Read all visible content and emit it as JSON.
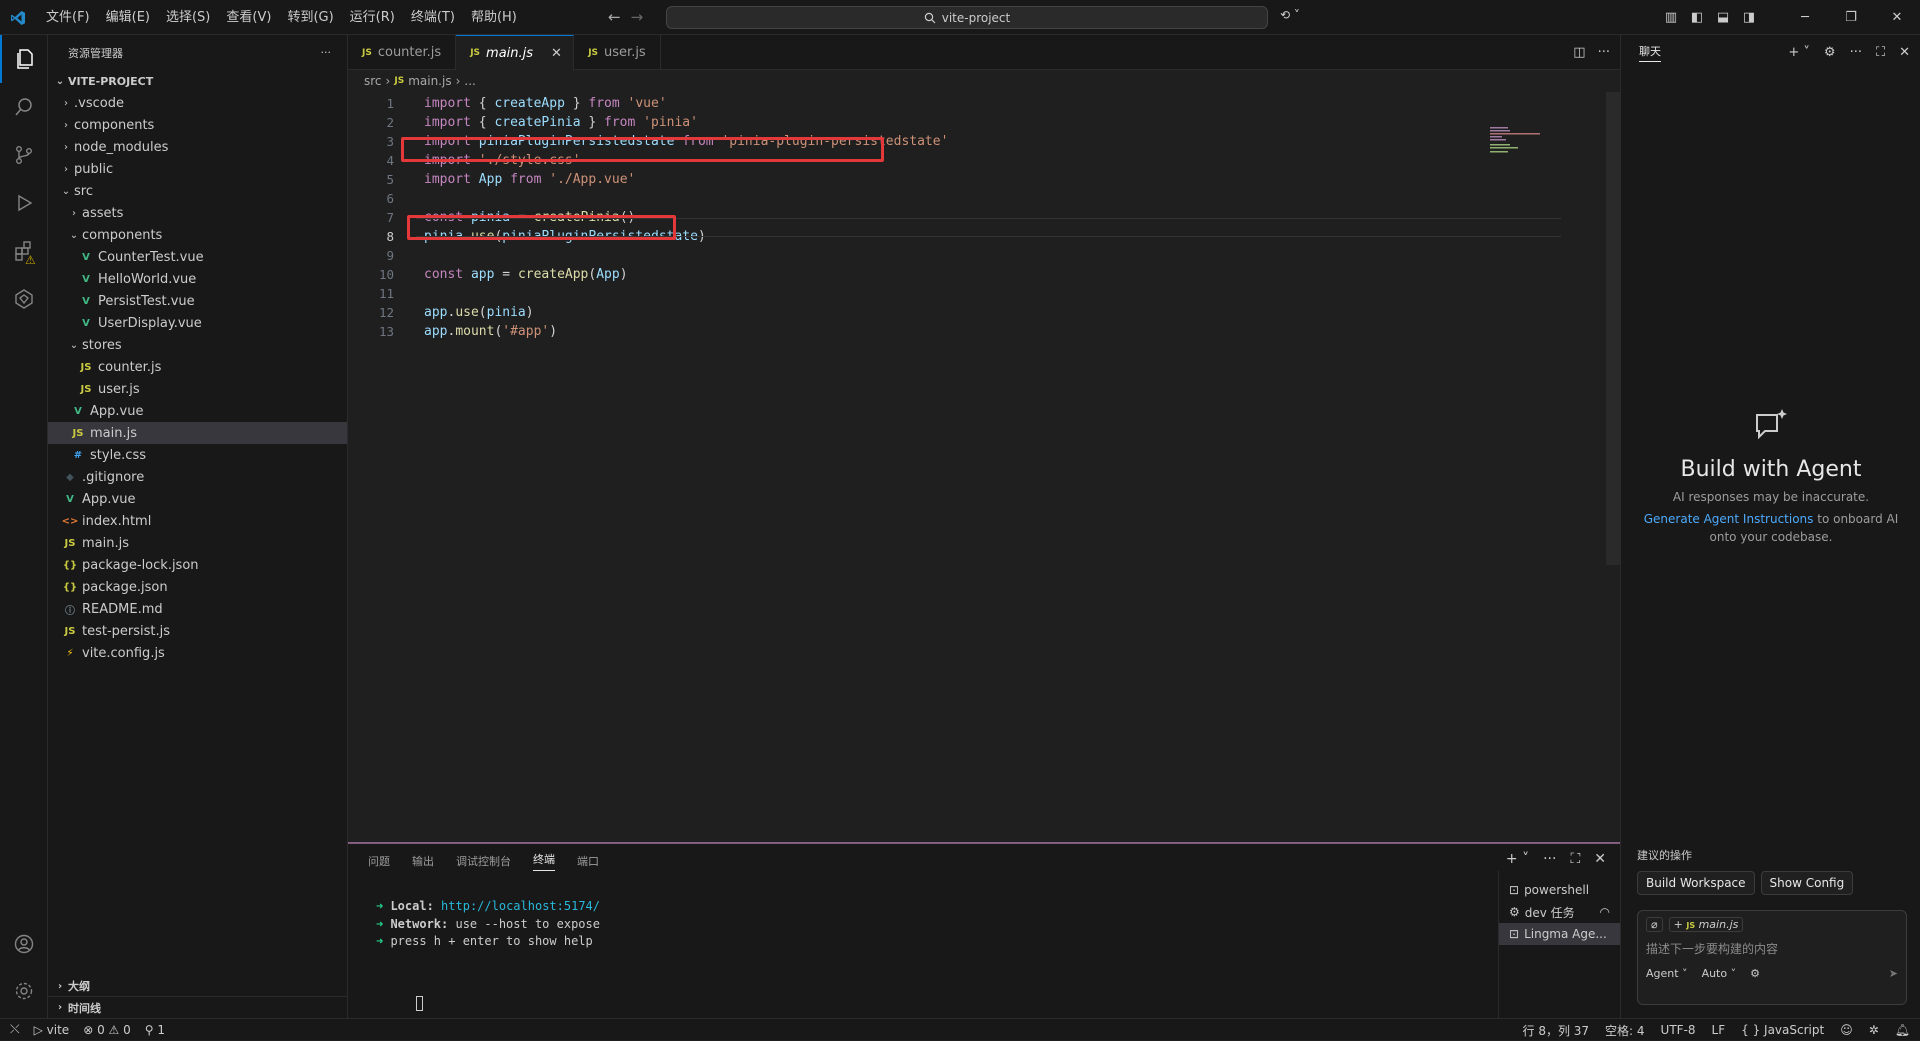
{
  "menu": [
    "文件(F)",
    "编辑(E)",
    "选择(S)",
    "查看(V)",
    "转到(G)",
    "运行(R)",
    "终端(T)",
    "帮助(H)"
  ],
  "search": {
    "text": "vite-project"
  },
  "sidebar": {
    "title": "资源管理器",
    "root": "VITE-PROJECT",
    "tree": [
      {
        "label": ".vscode",
        "depth": 0,
        "kind": "folder",
        "open": false
      },
      {
        "label": "components",
        "depth": 0,
        "kind": "folder",
        "open": false
      },
      {
        "label": "node_modules",
        "depth": 0,
        "kind": "folder",
        "open": false
      },
      {
        "label": "public",
        "depth": 0,
        "kind": "folder",
        "open": false
      },
      {
        "label": "src",
        "depth": 0,
        "kind": "folder",
        "open": true
      },
      {
        "label": "assets",
        "depth": 1,
        "kind": "folder",
        "open": false
      },
      {
        "label": "components",
        "depth": 1,
        "kind": "folder",
        "open": true
      },
      {
        "label": "CounterTest.vue",
        "depth": 2,
        "kind": "vue"
      },
      {
        "label": "HelloWorld.vue",
        "depth": 2,
        "kind": "vue"
      },
      {
        "label": "PersistTest.vue",
        "depth": 2,
        "kind": "vue"
      },
      {
        "label": "UserDisplay.vue",
        "depth": 2,
        "kind": "vue"
      },
      {
        "label": "stores",
        "depth": 1,
        "kind": "folder",
        "open": true
      },
      {
        "label": "counter.js",
        "depth": 2,
        "kind": "js"
      },
      {
        "label": "user.js",
        "depth": 2,
        "kind": "js"
      },
      {
        "label": "App.vue",
        "depth": 1,
        "kind": "vue"
      },
      {
        "label": "main.js",
        "depth": 1,
        "kind": "js",
        "selected": true
      },
      {
        "label": "style.css",
        "depth": 1,
        "kind": "css"
      },
      {
        "label": ".gitignore",
        "depth": 0,
        "kind": "git"
      },
      {
        "label": "App.vue",
        "depth": 0,
        "kind": "vue"
      },
      {
        "label": "index.html",
        "depth": 0,
        "kind": "html"
      },
      {
        "label": "main.js",
        "depth": 0,
        "kind": "js"
      },
      {
        "label": "package-lock.json",
        "depth": 0,
        "kind": "json"
      },
      {
        "label": "package.json",
        "depth": 0,
        "kind": "json"
      },
      {
        "label": "README.md",
        "depth": 0,
        "kind": "info"
      },
      {
        "label": "test-persist.js",
        "depth": 0,
        "kind": "js"
      },
      {
        "label": "vite.config.js",
        "depth": 0,
        "kind": "vite"
      }
    ],
    "outline": "大纲",
    "timeline": "时间线"
  },
  "tabs": [
    {
      "label": "counter.js",
      "active": false
    },
    {
      "label": "main.js",
      "active": true
    },
    {
      "label": "user.js",
      "active": false
    }
  ],
  "breadcrumb": {
    "folder": "src",
    "file": "main.js",
    "more": "..."
  },
  "code": [
    "import { createApp } from 'vue'",
    "import { createPinia } from 'pinia'",
    "import piniaPluginPersistedstate from 'pinia-plugin-persistedstate'",
    "import './style.css'",
    "import App from './App.vue'",
    "",
    "const pinia = createPinia()",
    "pinia.use(piniaPluginPersistedstate)",
    "",
    "const app = createApp(App)",
    "",
    "app.use(pinia)",
    "app.mount('#app')"
  ],
  "cursor_line": 8,
  "highlighted_lines": [
    3,
    8
  ],
  "panel": {
    "tabs": [
      "问题",
      "输出",
      "调试控制台",
      "终端",
      "端口"
    ],
    "active_tab": "终端",
    "terminal": {
      "local_label": "Local:",
      "local_url": "http://localhost:5174/",
      "network_label": "Network:",
      "network_text": "use --host to expose",
      "help_text": "press h + enter to show help"
    },
    "terminals": [
      "powershell",
      "dev 任务",
      "Lingma Age..."
    ]
  },
  "chat": {
    "title": "聊天",
    "heading": "Build with Agent",
    "sub": "AI responses may be inaccurate.",
    "link": "Generate Agent Instructions",
    "link_rest": "to onboard AI onto your codebase.",
    "suggest_label": "建议的操作",
    "buttons": [
      "Build Workspace",
      "Show Config"
    ],
    "context_file": "main.js",
    "placeholder": "描述下一步要构建的内容",
    "mode": "Agent",
    "model": "Auto"
  },
  "status": {
    "branch": "vite",
    "errors": "0",
    "warnings": "0",
    "ports": "1",
    "position": "行 8，列 37",
    "spaces": "空格: 4",
    "encoding": "UTF-8",
    "eol": "LF",
    "language": "JavaScript"
  }
}
